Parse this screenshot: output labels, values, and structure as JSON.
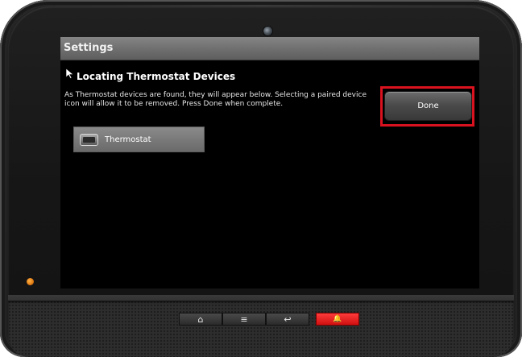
{
  "window": {
    "title": "Settings"
  },
  "section": {
    "title": "Locating Thermostat Devices",
    "description_lines": [
      "As Thermostat devices are found, they will appear below.  Selecting a paired device",
      "icon will allow it to be removed.  Press Done when complete."
    ]
  },
  "actions": {
    "done_label": "Done",
    "highlight_color": "#d9121f"
  },
  "devices": [
    {
      "label": "Thermostat",
      "icon": "thermostat-icon"
    }
  ],
  "navigation": {
    "home_icon": "⌂",
    "menu_icon": "≡",
    "back_icon": "↩",
    "alert_icon": "🔔",
    "alert_color": "#e01818"
  },
  "hardware": {
    "indicator_led_color": "#e07a12"
  }
}
